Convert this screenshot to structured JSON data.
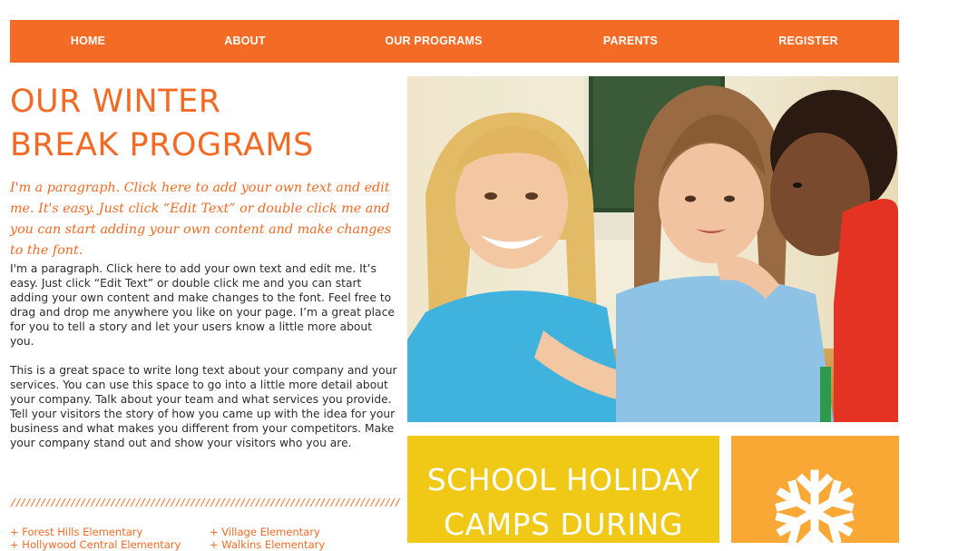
{
  "nav": {
    "items": [
      {
        "label": "HOME"
      },
      {
        "label": "ABOUT"
      },
      {
        "label": "OUR PROGRAMS"
      },
      {
        "label": "PARENTS"
      },
      {
        "label": "REGISTER"
      }
    ]
  },
  "main": {
    "title_line1": "OUR WINTER",
    "title_line2": "BREAK PROGRAMS",
    "lead": "I'm a paragraph. Click here to add your own text and edit me. It's easy. Just click “Edit Text” or double click me and you can start adding your own content and make changes to the font.",
    "paragraph1": "I'm a paragraph. Click here to add your own text and edit me. It’s easy. Just click “Edit Text” or double click me and you can start adding your own content and make changes to the font. Feel free to drag and drop me anywhere you like on your page. I’m a great place for you to tell a story and let your users know a little more about you.",
    "paragraph2": "This is a great space to write long text about your company and your services. You can use this space to go into a little more detail about your company. Talk about your team and what services you provide. Tell your visitors the story of how you came up with the idea for your business and what makes you different from your competitors. Make your company stand out and show your visitors who you are.",
    "divider": "////////////////////////////////////////////////////////////////////////////////////////////////////////////////////////////////////////////////////////////////////////"
  },
  "schools": [
    {
      "label": "+ Forest Hills Elementary"
    },
    {
      "label": "+ Village Elementary"
    },
    {
      "label": "+ Hollywood Central Elementary"
    },
    {
      "label": "+ Walkins Elementary"
    }
  ],
  "promo": {
    "title_line1": "SCHOOL HOLIDAY",
    "title_line2": "CAMPS DURING"
  },
  "colors": {
    "accent_orange": "#f46b26",
    "promo_yellow": "#efc915",
    "promo_orange": "#f9a836"
  },
  "icons": {
    "promo_icon": "snowflake-icon"
  }
}
